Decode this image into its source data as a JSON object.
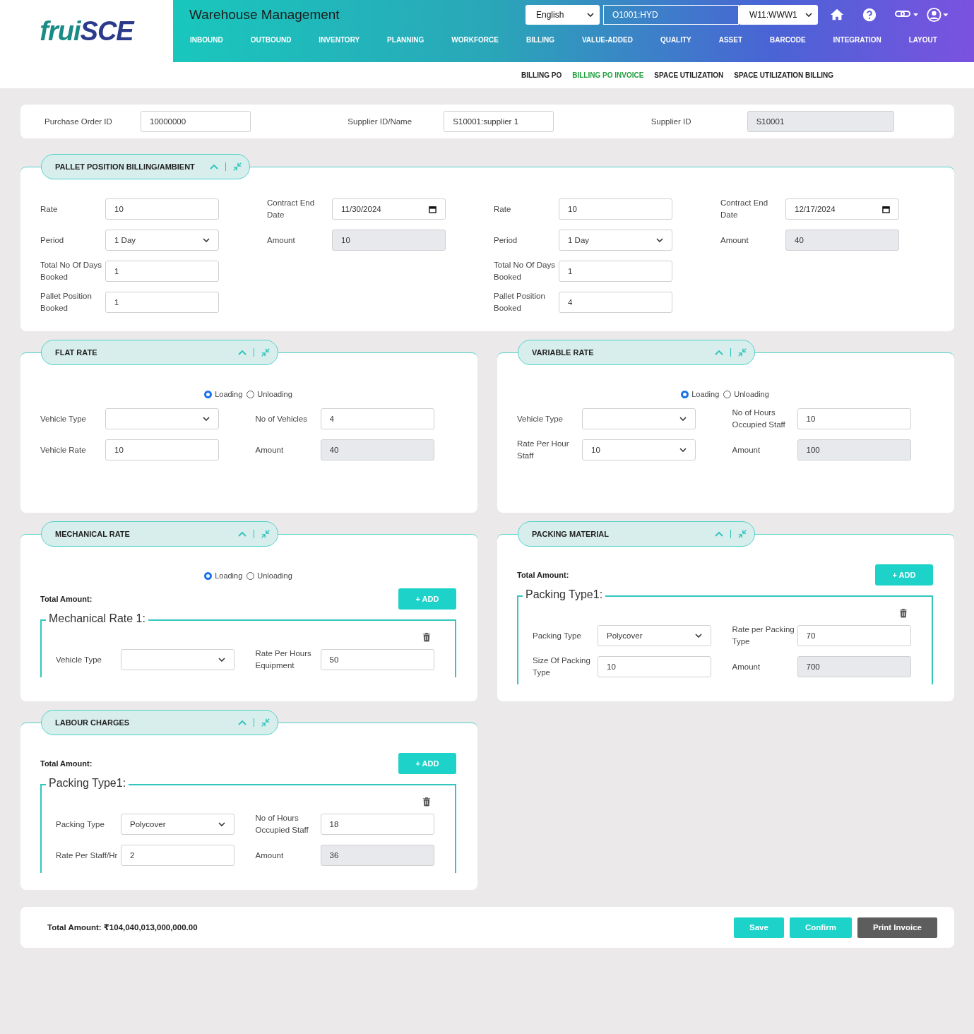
{
  "header": {
    "logo_a": "frui",
    "logo_b": "SCE",
    "title": "Warehouse Management",
    "language": "English",
    "org": "O1001:HYD",
    "warehouse": "W11:WWW1"
  },
  "nav": [
    {
      "label": "INBOUND"
    },
    {
      "label": "OUTBOUND"
    },
    {
      "label": "INVENTORY"
    },
    {
      "label": "PLANNING"
    },
    {
      "label": "WORKFORCE"
    },
    {
      "label": "BILLING"
    },
    {
      "label": "VALUE-ADDED"
    },
    {
      "label": "QUALITY"
    },
    {
      "label": "ASSET"
    },
    {
      "label": "BARCODE"
    },
    {
      "label": "INTEGRATION"
    },
    {
      "label": "LAYOUT"
    }
  ],
  "subnav": [
    {
      "label": "BILLING PO",
      "selected": false
    },
    {
      "label": "BILLING PO INVOICE",
      "selected": true
    },
    {
      "label": "SPACE UTILIZATION",
      "selected": false
    },
    {
      "label": "SPACE UTILIZATION BILLING",
      "selected": false
    }
  ],
  "top_fields": [
    {
      "label": "Purchase Order ID",
      "value": "10000000",
      "kind": "input"
    },
    {
      "label": "Supplier ID/Name",
      "value": "S10001:supplier 1",
      "kind": "input"
    },
    {
      "label": "Supplier ID",
      "value": "S10001",
      "kind": "readonly"
    }
  ],
  "panels": [
    {
      "title": "PALLET POSITION BILLING/AMBIENT",
      "kind": "wide",
      "columns": [
        [
          {
            "label": "Rate",
            "value": "10",
            "kind": "input"
          },
          {
            "label": "Period",
            "value": "1 Day",
            "kind": "select"
          },
          {
            "label": "Total No Of Days Booked",
            "value": "1",
            "kind": "input"
          },
          {
            "label": "Pallet Position Booked",
            "value": "1",
            "kind": "input"
          }
        ],
        [
          {
            "label": "Contract End Date",
            "value": "11/30/2024",
            "kind": "date"
          },
          {
            "label": "Amount",
            "value": "10",
            "kind": "readonly"
          }
        ],
        [
          {
            "label": "Rate",
            "value": "10",
            "kind": "input"
          },
          {
            "label": "Period",
            "value": "1 Day",
            "kind": "select"
          },
          {
            "label": "Total No Of Days Booked",
            "value": "1",
            "kind": "input"
          },
          {
            "label": "Pallet Position Booked",
            "value": "4",
            "kind": "input"
          }
        ],
        [
          {
            "label": "Contract End Date",
            "value": "12/17/2024",
            "kind": "date"
          },
          {
            "label": "Amount",
            "value": "40",
            "kind": "readonly"
          }
        ]
      ]
    },
    {
      "title": "FLAT RATE",
      "kind": "narrow",
      "radios": [
        {
          "label": "Loading",
          "selected": true
        },
        {
          "label": "Unloading",
          "selected": false
        }
      ],
      "columns": [
        [
          {
            "label": "Vehicle Type",
            "kind": "select"
          },
          {
            "label": "Vehicle Rate",
            "value": "10",
            "kind": "input"
          }
        ],
        [
          {
            "label": "No of Vehicles",
            "value": "4",
            "kind": "input"
          },
          {
            "label": "Amount",
            "value": "40",
            "kind": "readonly"
          }
        ]
      ]
    },
    {
      "title": "VARIABLE RATE",
      "kind": "narrow",
      "radios": [
        {
          "label": "Loading",
          "selected": true
        },
        {
          "label": "Unloading",
          "selected": false
        }
      ],
      "columns": [
        [
          {
            "label": "Vehicle Type",
            "kind": "select"
          },
          {
            "label": "Rate Per Hour Staff",
            "value": "10",
            "kind": "select"
          }
        ],
        [
          {
            "label": "No of Hours Occupied Staff",
            "value": "10",
            "kind": "input"
          },
          {
            "label": "Amount",
            "value": "100",
            "kind": "readonly"
          }
        ]
      ]
    },
    {
      "title": "MECHANICAL RATE",
      "kind": "narrow",
      "radios": [
        {
          "label": "Loading",
          "selected": true
        },
        {
          "label": "Unloading",
          "selected": false
        }
      ],
      "total_label": "Total Amount:",
      "add_label": "+ ADD",
      "group_title": "Mechanical Rate 1:",
      "columns": [
        [
          {
            "label": "Vehicle Type",
            "kind": "select"
          }
        ],
        [
          {
            "label": "Rate Per Hours Equipment",
            "value": "50",
            "kind": "input"
          }
        ]
      ]
    },
    {
      "title": "PACKING MATERIAL",
      "kind": "narrow",
      "total_label": "Total Amount:",
      "add_label": "+ ADD",
      "group_title": "Packing Type1:",
      "columns": [
        [
          {
            "label": "Packing Type",
            "value": "Polycover",
            "kind": "select"
          },
          {
            "label": "Size Of Packing Type",
            "value": "10",
            "kind": "input"
          }
        ],
        [
          {
            "label": "Rate per Packing Type",
            "value": "70",
            "kind": "input"
          },
          {
            "label": "Amount",
            "value": "700",
            "kind": "readonly"
          }
        ]
      ]
    },
    {
      "title": "LABOUR CHARGES",
      "kind": "narrow",
      "total_label": "Total Amount:",
      "add_label": "+ ADD",
      "group_title": "Packing Type1:",
      "columns": [
        [
          {
            "label": "Packing Type",
            "value": "Polycover",
            "kind": "select"
          },
          {
            "label": "Rate Per Staff/Hr",
            "value": "2",
            "kind": "input"
          }
        ],
        [
          {
            "label": "No of Hours Occupied Staff",
            "value": "18",
            "kind": "input"
          },
          {
            "label": "Amount",
            "value": "36",
            "kind": "readonly"
          }
        ]
      ]
    }
  ],
  "footer": {
    "total": "Total Amount: ₹104,040,013,000,000.00",
    "buttons": [
      {
        "label": "Save",
        "kind": "primary"
      },
      {
        "label": "Confirm",
        "kind": "primary"
      },
      {
        "label": "Print Invoice",
        "kind": "dark"
      }
    ]
  }
}
